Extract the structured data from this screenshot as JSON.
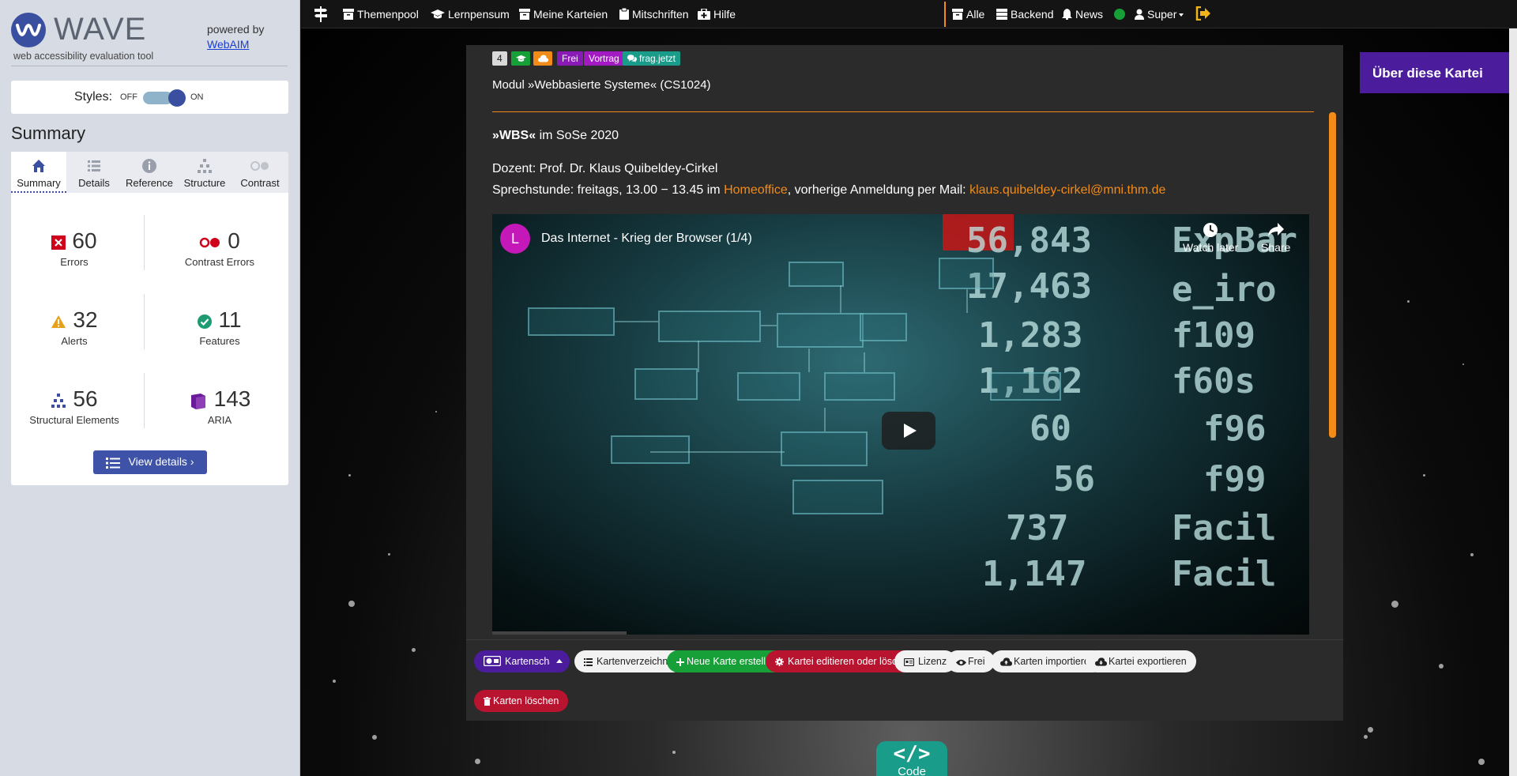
{
  "wave": {
    "title": "WAVE",
    "tagline": "web accessibility evaluation tool",
    "powered_by": "powered by",
    "webaim_link": "WebAIM",
    "styles": {
      "label": "Styles:",
      "off": "OFF",
      "on": "ON",
      "enabled": true
    },
    "summary_heading": "Summary",
    "tabs": [
      {
        "label": "Summary",
        "icon": "home-icon",
        "active": true
      },
      {
        "label": "Details",
        "icon": "list-icon"
      },
      {
        "label": "Reference",
        "icon": "info-icon"
      },
      {
        "label": "Structure",
        "icon": "hierarchy-icon"
      },
      {
        "label": "Contrast",
        "icon": "contrast-icon"
      }
    ],
    "stats": {
      "errors": {
        "value": "60",
        "label": "Errors",
        "color": "#d0021b"
      },
      "contrast_errors": {
        "value": "0",
        "label": "Contrast Errors",
        "color": "#d0021b"
      },
      "alerts": {
        "value": "32",
        "label": "Alerts",
        "color": "#e8a019"
      },
      "features": {
        "value": "11",
        "label": "Features",
        "color": "#1d9b72"
      },
      "structural": {
        "value": "56",
        "label": "Structural Elements",
        "color": "#3b4fa0"
      },
      "aria": {
        "value": "143",
        "label": "ARIA",
        "color": "#6a1b9a"
      }
    },
    "view_details": "View details ›"
  },
  "nav": {
    "left": [
      {
        "label": "Themenpool",
        "icon": "archive-icon"
      },
      {
        "label": "Lernpensum",
        "icon": "graduation-cap-icon"
      },
      {
        "label": "Meine Karteien",
        "icon": "archive-icon"
      },
      {
        "label": "Mitschriften",
        "icon": "clipboard-icon"
      },
      {
        "label": "Hilfe",
        "icon": "medkit-icon"
      }
    ],
    "right": [
      {
        "label": "Alle",
        "icon": "archive-icon"
      },
      {
        "label": "Backend",
        "icon": "database-icon"
      },
      {
        "label": "News",
        "icon": "bell-icon"
      },
      {
        "label": "Super",
        "icon": "user-icon"
      }
    ],
    "accent": "#f28c18"
  },
  "card": {
    "badges": [
      {
        "label": "4",
        "color": "#d9d9d9",
        "text_color": "#222"
      },
      {
        "label": "",
        "icon": "graduation-cap-icon",
        "color": "#18a038"
      },
      {
        "label": "",
        "icon": "cloud-icon",
        "color": "#f28c18"
      },
      {
        "label": "Frei",
        "color": "#8a1ab5"
      },
      {
        "label": "Vortrag",
        "color": "#a31ac2"
      },
      {
        "label": "frag.jetzt",
        "icon": "comments-icon",
        "color": "#1a9c8a"
      }
    ],
    "title": "Modul »Webbasierte Systeme« (CS1024)",
    "about": "Über diese Kartei",
    "course_bold": "»WBS«",
    "course_rest": " im SoSe 2020",
    "lecturer": "Dozent: Prof. Dr. Klaus Quibeldey-Cirkel",
    "hours_prefix": "Sprechstunde: freitags, 13.00 − 13.45 im ",
    "hours_link": "Homeoffice",
    "hours_mid": ", vorherige Anmeldung per Mail: ",
    "hours_mail": "klaus.quibeldey-cirkel@mni.thm.de",
    "video": {
      "channel_initial": "L",
      "title": "Das Internet - Krieg der Browser (1/4)",
      "watch_later": "Watch later",
      "share": "Share",
      "footage_text": [
        "56,843",
        "17,463",
        "1,283",
        "1,162",
        "60",
        "56",
        "737",
        "1,147",
        "e_iro",
        "f109",
        "f60s",
        "f96",
        "f99",
        "Facil",
        "Facil",
        "ExpBar"
      ]
    }
  },
  "actions": {
    "buttons": [
      {
        "label": "Kartenschau",
        "icon": "projector-icon",
        "style": "purple"
      },
      {
        "label": "",
        "icon": "caret-up-icon",
        "style": "purple"
      },
      {
        "label": "Kartenverzeichnis",
        "icon": "list-icon",
        "style": "light"
      },
      {
        "label": "Neue Karte erstellen",
        "icon": "plus-icon",
        "style": "green"
      },
      {
        "label": "Kartei editieren oder löschen",
        "icon": "gear-icon",
        "style": "red"
      },
      {
        "label": "Lizenz",
        "icon": "license-icon",
        "style": "light"
      },
      {
        "label": "Frei",
        "icon": "eye-icon",
        "style": "light"
      },
      {
        "label": "Karten importieren",
        "icon": "cloud-upload-icon",
        "style": "light"
      },
      {
        "label": "Kartei exportieren",
        "icon": "cloud-download-icon",
        "style": "light"
      },
      {
        "label": "Karten löschen",
        "icon": "trash-icon",
        "style": "red"
      }
    ]
  },
  "code_button": {
    "icon": "</>",
    "label": "Code",
    "color": "#1a9c8a"
  }
}
